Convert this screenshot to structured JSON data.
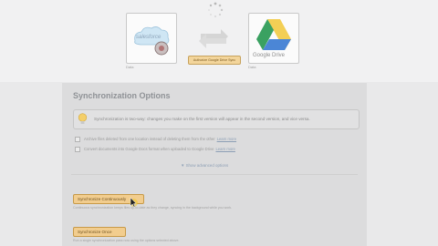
{
  "header": {
    "source_app": {
      "logo_text": "salesforce",
      "caption": "Data"
    },
    "target_app": {
      "logo_text": "Google Drive",
      "caption": "Data"
    },
    "auth_button_label": "Authorize Google Drive Sync"
  },
  "options": {
    "title": "Synchronization Options",
    "notice": "Synchronization is two-way: changes you make on the first version will appear in the second version, and vice versa.",
    "items": [
      {
        "label": "Archive files deleted from one location instead of deleting them from the other",
        "link": "Learn more"
      },
      {
        "label": "Convert documents into Google Docs format when uploaded to Google Drive",
        "link": "Learn more"
      }
    ],
    "advanced_link": "▼ Show advanced options",
    "buttons": {
      "continuous": {
        "label": "Synchronize Continuously",
        "description": "Continuous synchronization keeps files up-to-date as they change, syncing in the background while you work."
      },
      "once": {
        "label": "Synchronize Once",
        "description": "Run a single synchronization pass now using the options selected above."
      }
    }
  },
  "colors": {
    "accent_button": "#f2cd8e",
    "title": "#8f9296",
    "link": "#8d9fb5"
  }
}
